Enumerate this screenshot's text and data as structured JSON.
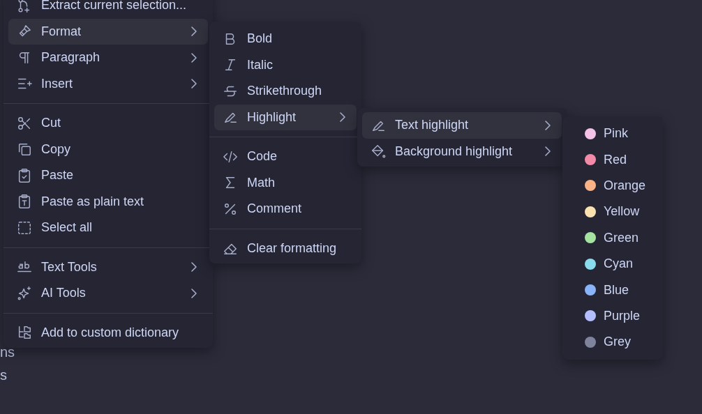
{
  "background_text": [
    "ns",
    "s"
  ],
  "context_menu": {
    "groups": [
      [
        {
          "label": "Extract current selection...",
          "submenu": false,
          "selected": false
        },
        {
          "label": "Format",
          "submenu": true,
          "selected": true
        },
        {
          "label": "Paragraph",
          "submenu": true,
          "selected": false
        },
        {
          "label": "Insert",
          "submenu": true,
          "selected": false
        }
      ],
      [
        {
          "label": "Cut",
          "submenu": false,
          "selected": false
        },
        {
          "label": "Copy",
          "submenu": false,
          "selected": false
        },
        {
          "label": "Paste",
          "submenu": false,
          "selected": false
        },
        {
          "label": "Paste as plain text",
          "submenu": false,
          "selected": false
        },
        {
          "label": "Select all",
          "submenu": false,
          "selected": false
        }
      ],
      [
        {
          "label": "Text Tools",
          "submenu": true,
          "selected": false
        },
        {
          "label": "AI Tools",
          "submenu": true,
          "selected": false
        }
      ],
      [
        {
          "label": "Add to custom dictionary",
          "submenu": false,
          "selected": false
        }
      ]
    ]
  },
  "format_menu": {
    "groups": [
      [
        {
          "label": "Bold",
          "submenu": false,
          "selected": false
        },
        {
          "label": "Italic",
          "submenu": false,
          "selected": false
        },
        {
          "label": "Strikethrough",
          "submenu": false,
          "selected": false
        },
        {
          "label": "Highlight",
          "submenu": true,
          "selected": true
        }
      ],
      [
        {
          "label": "Code",
          "submenu": false,
          "selected": false
        },
        {
          "label": "Math",
          "submenu": false,
          "selected": false
        },
        {
          "label": "Comment",
          "submenu": false,
          "selected": false
        }
      ],
      [
        {
          "label": "Clear formatting",
          "submenu": false,
          "selected": false
        }
      ]
    ]
  },
  "highlight_menu": {
    "groups": [
      [
        {
          "label": "Text highlight",
          "submenu": true,
          "selected": true
        },
        {
          "label": "Background highlight",
          "submenu": true,
          "selected": false
        }
      ]
    ]
  },
  "color_menu": {
    "items": [
      {
        "label": "Pink",
        "color": "#f5c2e7"
      },
      {
        "label": "Red",
        "color": "#f38ba8"
      },
      {
        "label": "Orange",
        "color": "#fab387"
      },
      {
        "label": "Yellow",
        "color": "#f9e2af"
      },
      {
        "label": "Green",
        "color": "#a6e3a1"
      },
      {
        "label": "Cyan",
        "color": "#89dceb"
      },
      {
        "label": "Blue",
        "color": "#89b4fa"
      },
      {
        "label": "Purple",
        "color": "#b4befe"
      },
      {
        "label": "Grey",
        "color": "#7f849c"
      }
    ]
  }
}
